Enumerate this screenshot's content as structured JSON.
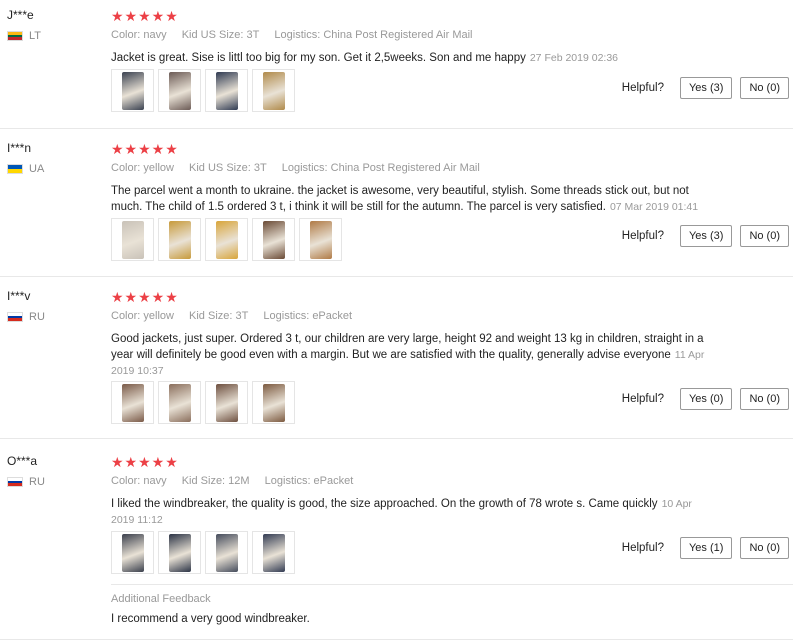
{
  "reviews": [
    {
      "user": "J***e",
      "country": "LT",
      "flag_colors": [
        "#fdb913",
        "#006a44",
        "#c1272d"
      ],
      "stars": "★★★★★",
      "color": "Color: navy",
      "size": "Kid US Size: 3T",
      "logistics": "Logistics: China Post Registered Air Mail",
      "text": "Jacket is great. Sise is littl too big for my son. Get it 2,5weeks. Son and me happy",
      "date": "27 Feb 2019 02:36",
      "helpful_label": "Helpful?",
      "yes": "Yes (3)",
      "no": "No (0)",
      "thumb_colors": [
        "#3a4150",
        "#6b5a55",
        "#2f3a52",
        "#b08a4a"
      ]
    },
    {
      "user": "I***n",
      "country": "UA",
      "flag_colors": [
        "#0057b7",
        "#ffd700"
      ],
      "stars": "★★★★★",
      "color": "Color: yellow",
      "size": "Kid US Size: 3T",
      "logistics": "Logistics: China Post Registered Air Mail",
      "text": "The parcel went a month to ukraine. the jacket is awesome, very beautiful, stylish. Some threads stick out, but not much. The child of 1.5 ordered 3 t, i think it will be still for the autumn. The parcel is very satisfied.",
      "date": "07 Mar 2019 01:41",
      "helpful_label": "Helpful?",
      "yes": "Yes (3)",
      "no": "No (0)",
      "thumb_colors": [
        "#c9c2b8",
        "#c79a3a",
        "#d8a53a",
        "#6a4a35",
        "#b07a45"
      ]
    },
    {
      "user": "I***v",
      "country": "RU",
      "flag_colors": [
        "#ffffff",
        "#0039a6",
        "#d52b1e"
      ],
      "stars": "★★★★★",
      "color": "Color: yellow",
      "size": "Kid Size: 3T",
      "logistics": "Logistics: ePacket",
      "text": "Good jackets, just super. Ordered 3 t, our children are very large, height 92 and weight 13 kg in children, straight in a year will definitely be good even with a margin. But we are satisfied with the quality, generally advise everyone",
      "date": "11 Apr 2019 10:37",
      "helpful_label": "Helpful?",
      "yes": "Yes (0)",
      "no": "No (0)",
      "thumb_colors": [
        "#7a5a48",
        "#8a6e5c",
        "#6e5040",
        "#7c5a40"
      ]
    },
    {
      "user": "O***a",
      "country": "RU",
      "flag_colors": [
        "#ffffff",
        "#0039a6",
        "#d52b1e"
      ],
      "stars": "★★★★★",
      "color": "Color: navy",
      "size": "Kid Size: 12M",
      "logistics": "Logistics: ePacket",
      "text": "I liked the windbreaker, the quality is good, the size approached. On the growth of 78 wrote s. Came quickly",
      "date": "10 Apr 2019 11:12",
      "helpful_label": "Helpful?",
      "yes": "Yes (1)",
      "no": "No (0)",
      "thumb_colors": [
        "#3a3f4c",
        "#2b3345",
        "#454c5c",
        "#323b52"
      ],
      "additional_title": "Additional Feedback",
      "additional_text": "I recommend a very good windbreaker."
    }
  ]
}
